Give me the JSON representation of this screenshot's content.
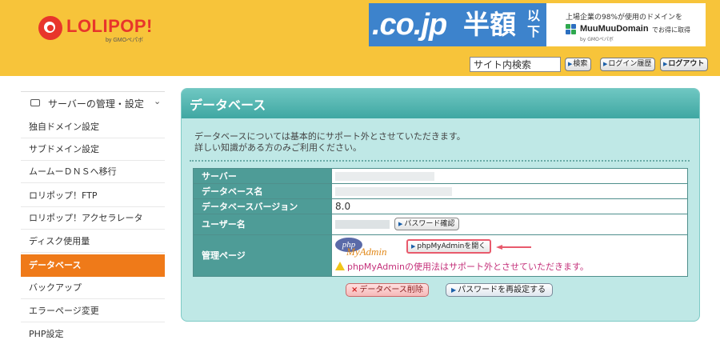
{
  "header": {
    "logo_text": "LOLIPOP!",
    "logo_sub": "by GMOペパボ",
    "banner": {
      "domain_text": ".co.jp",
      "half_text": "半額",
      "ika_text": "以下",
      "small_text": "上場企業の98%が使用のドメインを",
      "brand": "MuuMuuDomain",
      "otoku": "でお得に取得",
      "gmo": "by GMOペパボ"
    },
    "search_value": "サイト内検索",
    "buttons": {
      "search": "検索",
      "login_history": "ログイン履歴",
      "logout": "ログアウト"
    }
  },
  "sidebar": {
    "group_label": "サーバーの管理・設定",
    "items": [
      "独自ドメイン設定",
      "サブドメイン設定",
      "ムームーＤＮＳへ移行",
      "ロリポップ！FTP",
      "ロリポップ！アクセラレータ",
      "ディスク使用量",
      "データベース",
      "バックアップ",
      "エラーページ変更",
      "PHP設定"
    ],
    "active_index": 6
  },
  "main": {
    "title": "データベース",
    "notice_line1": "データベースについては基本的にサポート外とさせていただきます。",
    "notice_line2": "詳しい知識がある方のみご利用ください。",
    "rows": {
      "server": {
        "label": "サーバー"
      },
      "db_name": {
        "label": "データベース名"
      },
      "db_version": {
        "label": "データベースバージョン",
        "value": "8.0"
      },
      "user_name": {
        "label": "ユーザー名",
        "button": "パスワード確認"
      },
      "admin": {
        "label": "管理ページ",
        "logo_php": "php",
        "logo_myadmin": "MyAdmin",
        "open_button": "phpMyAdminを開く",
        "warning": "phpMyAdminの使用法はサポート外とさせていただきます。"
      }
    },
    "delete_button": "データベース削除",
    "reset_button": "パスワードを再設定する"
  },
  "colors": {
    "header_bg": "#f7c43a",
    "logo_red": "#e8352b",
    "active_orange": "#ef7a19",
    "panel_bg": "#bfe8e6",
    "table_header": "#4e9c97",
    "highlight_pink": "#e85a6c"
  },
  "icons": {
    "logo": "lolipop-logo-icon",
    "server": "server-icon",
    "chevron": "chevron-down-icon",
    "warning": "warning-icon",
    "arrow": "arrow-left-icon"
  }
}
